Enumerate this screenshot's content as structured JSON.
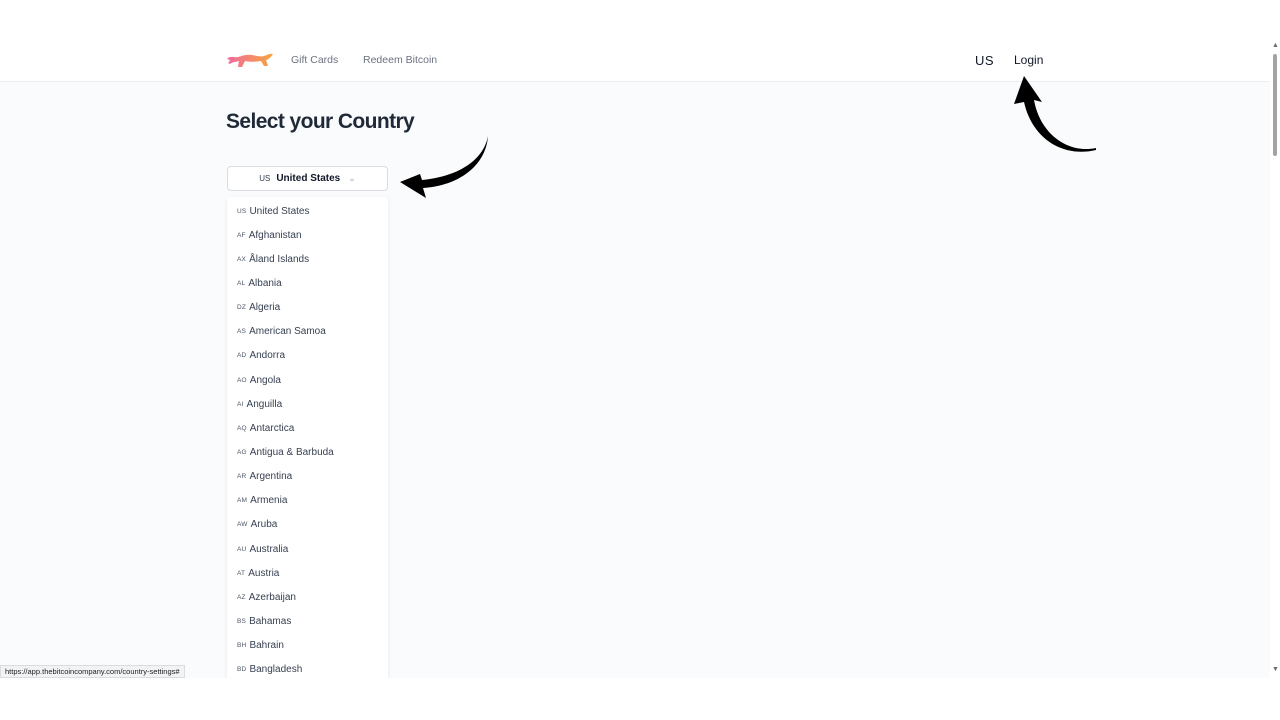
{
  "header": {
    "nav": [
      "Gift Cards",
      "Redeem Bitcoin"
    ],
    "country_code": "US",
    "login_label": "Login"
  },
  "main": {
    "title": "Select your Country",
    "country_select": {
      "selected_code": "US",
      "selected_name": "United States",
      "chevron": "⌄"
    },
    "options": [
      {
        "code": "US",
        "name": "United States"
      },
      {
        "code": "AF",
        "name": "Afghanistan"
      },
      {
        "code": "AX",
        "name": "Åland Islands"
      },
      {
        "code": "AL",
        "name": "Albania"
      },
      {
        "code": "DZ",
        "name": "Algeria"
      },
      {
        "code": "AS",
        "name": "American Samoa"
      },
      {
        "code": "AD",
        "name": "Andorra"
      },
      {
        "code": "AO",
        "name": "Angola"
      },
      {
        "code": "AI",
        "name": "Anguilla"
      },
      {
        "code": "AQ",
        "name": "Antarctica"
      },
      {
        "code": "AG",
        "name": "Antigua & Barbuda"
      },
      {
        "code": "AR",
        "name": "Argentina"
      },
      {
        "code": "AM",
        "name": "Armenia"
      },
      {
        "code": "AW",
        "name": "Aruba"
      },
      {
        "code": "AU",
        "name": "Australia"
      },
      {
        "code": "AT",
        "name": "Austria"
      },
      {
        "code": "AZ",
        "name": "Azerbaijan"
      },
      {
        "code": "BS",
        "name": "Bahamas"
      },
      {
        "code": "BH",
        "name": "Bahrain"
      },
      {
        "code": "BD",
        "name": "Bangladesh"
      }
    ]
  },
  "status_bar": {
    "url": "https://app.thebitcoincompany.com/country-settings#"
  },
  "icons": {
    "logo": "bitcoin-company-logo",
    "chevron": "chevron-down-icon",
    "annotation_arrows": [
      "arrow-pointing-to-select",
      "arrow-pointing-to-login"
    ]
  },
  "colors": {
    "logo_gradient": [
      "#f26aa0",
      "#f59e3d"
    ],
    "page_bg": "#fafbfc",
    "text": "#1f2937"
  }
}
